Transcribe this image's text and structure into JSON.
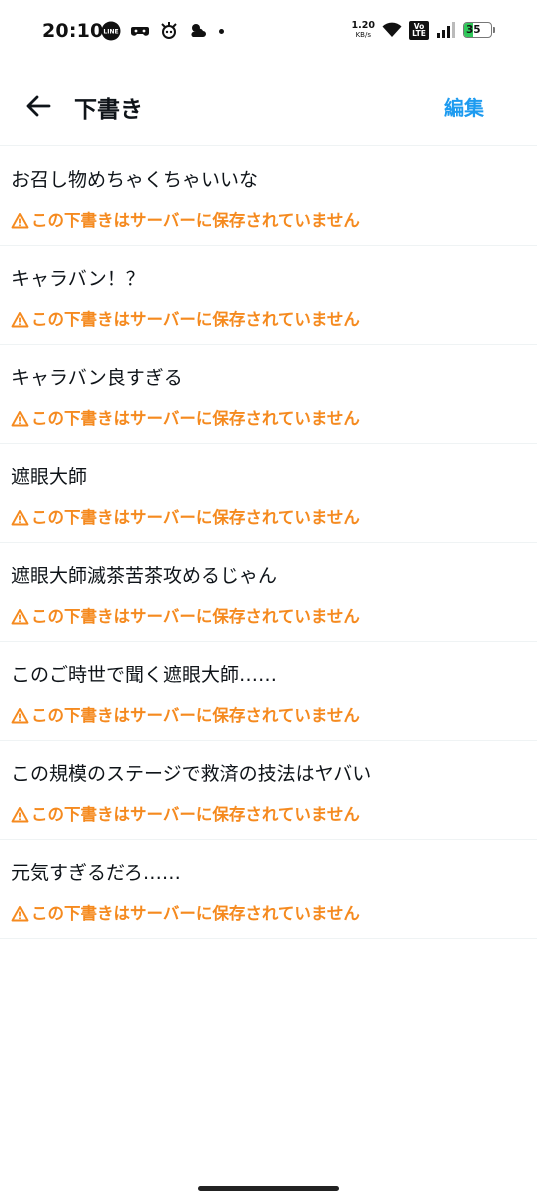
{
  "status_bar": {
    "time": "20:10",
    "line_icon_label": "LINE",
    "net_speed": "1.20",
    "net_unit": "KB/s",
    "volte_top": "Vo",
    "volte_bottom": "LTE",
    "battery_level": "35",
    "battery_color": "#30c85a"
  },
  "header": {
    "title": "下書き",
    "edit_label": "編集",
    "accent_color": "#1d9bf0"
  },
  "drafts": [
    {
      "text": "お召し物めちゃくちゃいいな",
      "warning": "この下書きはサーバーに保存されていません"
    },
    {
      "text": "キャラバン！？",
      "warning": "この下書きはサーバーに保存されていません"
    },
    {
      "text": "キャラバン良すぎる",
      "warning": "この下書きはサーバーに保存されていません"
    },
    {
      "text": "遮眼大師",
      "warning": "この下書きはサーバーに保存されていません"
    },
    {
      "text": "遮眼大師滅茶苦茶攻めるじゃん",
      "warning": "この下書きはサーバーに保存されていません"
    },
    {
      "text": "このご時世で聞く遮眼大師……",
      "warning": "この下書きはサーバーに保存されていません"
    },
    {
      "text": "この規模のステージで救済の技法はヤバい",
      "warning": "この下書きはサーバーに保存されていません"
    },
    {
      "text": "元気すぎるだろ……",
      "warning": "この下書きはサーバーに保存されていません"
    }
  ],
  "warning_color": "#f58a1f"
}
